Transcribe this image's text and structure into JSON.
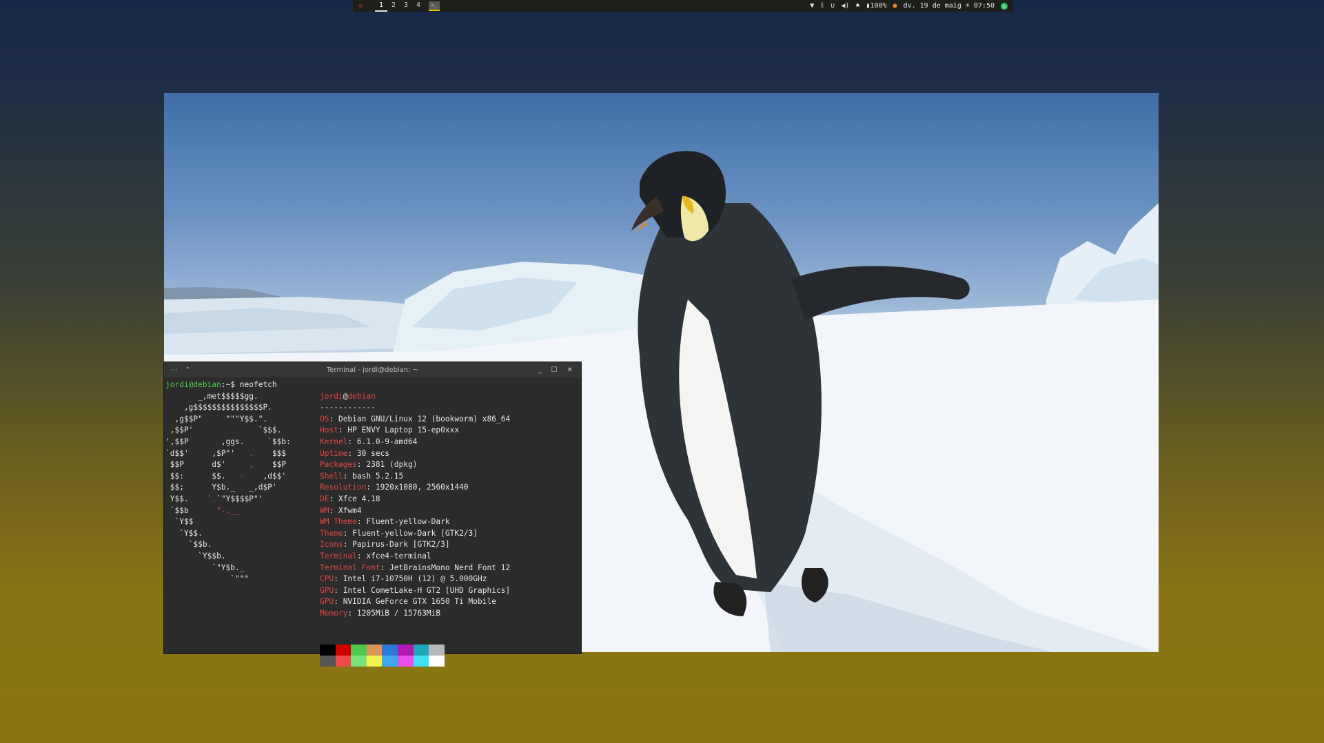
{
  "panel": {
    "apps_icon": "debian-swirl-icon",
    "workspaces": [
      "1",
      "2",
      "3",
      "4"
    ],
    "active_workspace": "1",
    "battery": "100%",
    "datetime": "dv. 19 de maig ☀ 07:50"
  },
  "terminal": {
    "title": "Terminal - jordi@debian: ~",
    "prompt_user": "jordi@debian",
    "prompt_rest": ":~$ neofetch",
    "header_user": "jordi",
    "header_at": "@",
    "header_host": "debian",
    "separator": "------------",
    "info": [
      {
        "key": "OS",
        "value": ": Debian GNU/Linux 12 (bookworm) x86_64"
      },
      {
        "key": "Host",
        "value": ": HP ENVY Laptop 15-ep0xxx"
      },
      {
        "key": "Kernel",
        "value": ": 6.1.0-9-amd64"
      },
      {
        "key": "Uptime",
        "value": ": 30 secs"
      },
      {
        "key": "Packages",
        "value": ": 2381 (dpkg)"
      },
      {
        "key": "Shell",
        "value": ": bash 5.2.15"
      },
      {
        "key": "Resolution",
        "value": ": 1920x1080, 2560x1440"
      },
      {
        "key": "DE",
        "value": ": Xfce 4.18"
      },
      {
        "key": "WM",
        "value": ": Xfwm4"
      },
      {
        "key": "WM Theme",
        "value": ": Fluent-yellow-Dark"
      },
      {
        "key": "Theme",
        "value": ": Fluent-yellow-Dark [GTK2/3]"
      },
      {
        "key": "Icons",
        "value": ": Papirus-Dark [GTK2/3]"
      },
      {
        "key": "Terminal",
        "value": ": xfce4-terminal"
      },
      {
        "key": "Terminal Font",
        "value": ": JetBrainsMono Nerd Font 12"
      },
      {
        "key": "CPU",
        "value": ": Intel i7-10750H (12) @ 5.000GHz"
      },
      {
        "key": "GPU",
        "value": ": Intel CometLake-H GT2 [UHD Graphics]"
      },
      {
        "key": "GPU",
        "value": ": NVIDIA GeForce GTX 1650 Ti Mobile"
      },
      {
        "key": "Memory",
        "value": ": 1205MiB / 15763MiB"
      }
    ],
    "palette_top": [
      "#000000",
      "#cc0000",
      "#4ec94e",
      "#d9955a",
      "#2f79d6",
      "#b01ab0",
      "#1ea7b8",
      "#b8b8b8"
    ],
    "palette_bottom": [
      "#555555",
      "#ef4a4a",
      "#7be37b",
      "#f4f24e",
      "#3fa6f0",
      "#e84ee8",
      "#3fe0ef",
      "#ffffff"
    ]
  },
  "colors": {
    "accent": "#e2c400",
    "key_red": "#e04545",
    "prompt_green": "#4ec94e"
  }
}
